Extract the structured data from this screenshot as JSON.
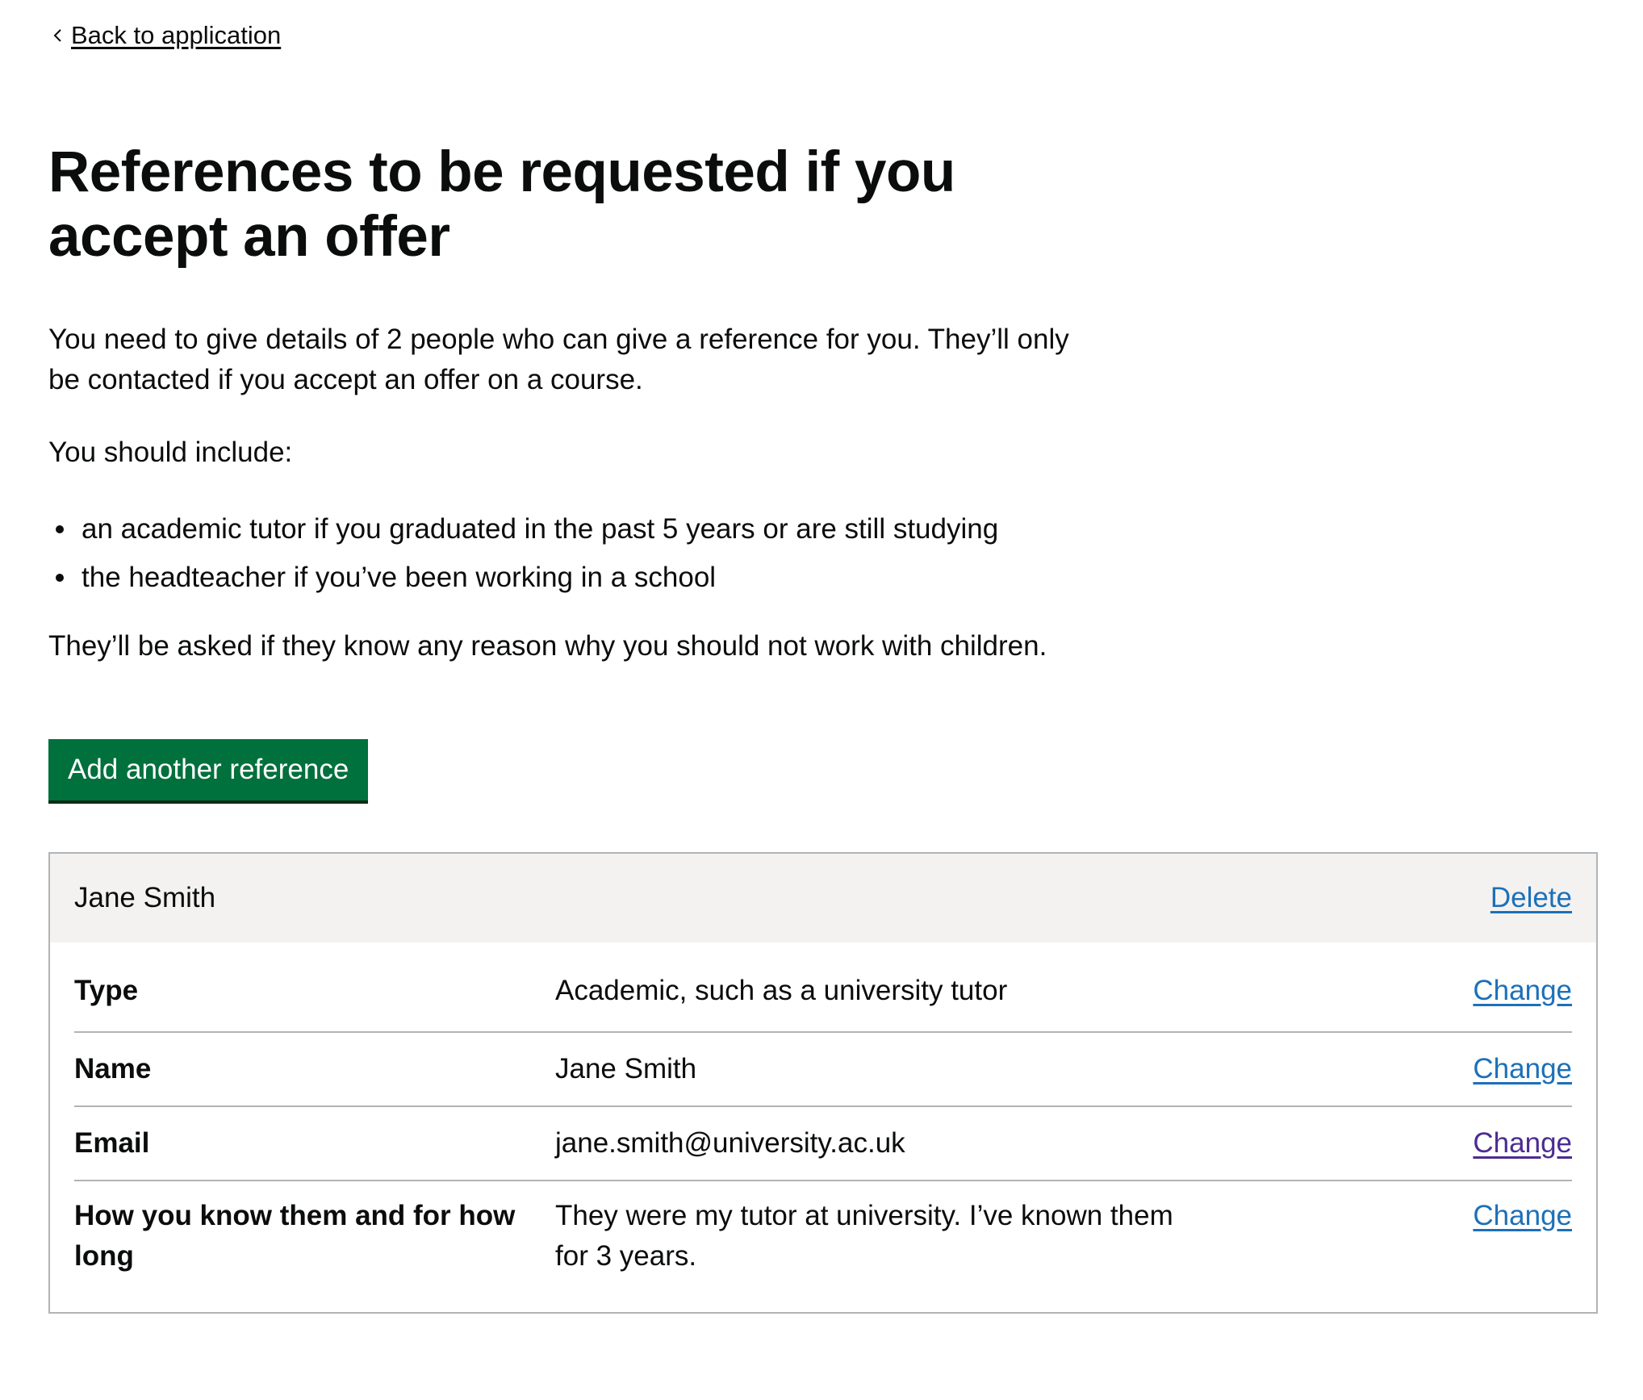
{
  "nav": {
    "back_label": "Back to application"
  },
  "page": {
    "title": "References to be requested if you accept an offer",
    "intro": "You need to give details of 2 people who can give a reference for you. They’ll only be contacted if you accept an offer on a course.",
    "include_lead": "You should include:",
    "include_items": [
      "an academic tutor if you graduated in the past 5 years or are still studying",
      "the headteacher if you’ve been working in a school"
    ],
    "warning": "They’ll be asked if they know any reason why you should not work with children.",
    "add_button_label": "Add another reference"
  },
  "reference_card": {
    "title": "Jane Smith",
    "delete_label": "Delete",
    "rows": [
      {
        "key": "Type",
        "value": "Academic, such as a university tutor",
        "action": "Change"
      },
      {
        "key": "Name",
        "value": "Jane Smith",
        "action": "Change"
      },
      {
        "key": "Email",
        "value": "jane.smith@university.ac.uk",
        "action": "Change"
      },
      {
        "key": "How you know them and for how long",
        "value": "They were my tutor at university. I’ve known them for 3 years.",
        "action": "Change"
      }
    ]
  },
  "colors": {
    "text": "#0b0c0c",
    "link": "#1d70b8",
    "link_visited": "#4c2c92",
    "button": "#00703c",
    "button_shadow": "#002d18",
    "card_header_bg": "#f3f2f1",
    "border": "#b1b4b6"
  },
  "icons": {
    "back": "chevron-left-icon"
  }
}
